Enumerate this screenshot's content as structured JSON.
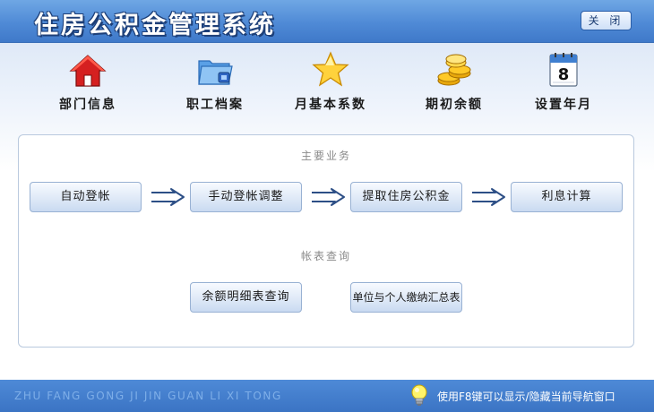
{
  "window": {
    "title": "住房公积金管理系统",
    "close_label": "关 闭"
  },
  "toolbar": {
    "items": [
      {
        "label": "部门信息",
        "icon": "house-icon"
      },
      {
        "label": "职工档案",
        "icon": "folder-icon"
      },
      {
        "label": "月基本系数",
        "icon": "star-icon"
      },
      {
        "label": "期初余额",
        "icon": "coins-icon"
      },
      {
        "label": "设置年月",
        "icon": "calendar-icon",
        "calendar_day": "8"
      }
    ]
  },
  "main_business": {
    "title": "主要业务",
    "steps": [
      "自动登帐",
      "手动登帐调整",
      "提取住房公积金",
      "利息计算"
    ]
  },
  "account_query": {
    "title": "帐表查询",
    "buttons": [
      "余额明细表查询",
      "单位与个人缴纳汇总表"
    ]
  },
  "statusbar": {
    "pinyin": "ZHU FANG GONG JI JIN GUAN LI XI TONG",
    "hint": "使用F8键可以显示/隐藏当前导航窗口"
  },
  "colors": {
    "title_bar": "#4f8ad6",
    "status_bar": "#3b74c4",
    "button_border": "#98b1d3"
  }
}
